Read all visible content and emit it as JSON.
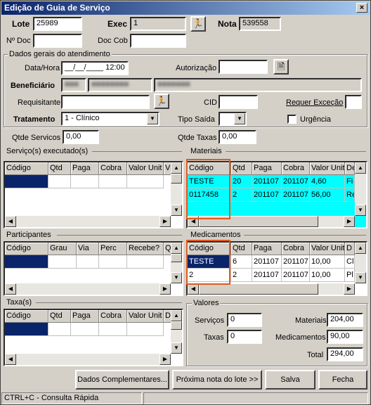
{
  "window": {
    "title": "Edição de Guia de Serviço",
    "close": "×"
  },
  "header": {
    "lote_label": "Lote",
    "lote": "25989",
    "exec_label": "Exec",
    "exec": "1",
    "nota_label": "Nota",
    "nota": "539558",
    "ndoc_label": "Nº Doc",
    "ndoc": "",
    "doccob_label": "Doc Cob",
    "doccob": ""
  },
  "dados": {
    "group_title": "Dados gerais do atendimento",
    "datahora_label": "Data/Hora",
    "datahora": "__/__/____ 12:00",
    "autorizacao_label": "Autorização",
    "autorizacao": "",
    "beneficiario_label": "Beneficiário",
    "requisitante_label": "Requisitante",
    "requisitante": "",
    "cid_label": "CID",
    "cid": "",
    "requer_label": "Requer Exceção",
    "requer": "",
    "tratamento_label": "Tratamento",
    "tratamento": "1 - Clínico",
    "tiposaida_label": "Tipo Saída",
    "tiposaida": "",
    "urgencia_label": "Urgência"
  },
  "qtde": {
    "servicos_label": "Qtde Servicos",
    "servicos": "0,00",
    "taxas_label": "Qtde Taxas",
    "taxas": "0,00"
  },
  "servicos": {
    "title": "Serviço(s) executado(s)",
    "columns": [
      "Código",
      "Qtd",
      "Paga",
      "Cobra",
      "Valor Unit",
      "Vi"
    ]
  },
  "materiais": {
    "title": "Materiais",
    "columns": [
      "Código",
      "Qtd",
      "Paga",
      "Cobra",
      "Valor Unit",
      "De"
    ],
    "rows": [
      [
        "TESTE",
        "20",
        "201107",
        "201107",
        "4,60",
        "Fi"
      ],
      [
        "0117458",
        "2",
        "201107",
        "201107",
        "56,00",
        "Re"
      ]
    ]
  },
  "participantes": {
    "title": "Participantes",
    "columns": [
      "Código",
      "Grau",
      "Via",
      "Perc",
      "Recebe?",
      "Q"
    ]
  },
  "medicamentos": {
    "title": "Medicamentos",
    "columns": [
      "Código",
      "Qtd",
      "Paga",
      "Cobra",
      "Valor Unit",
      "D"
    ],
    "rows": [
      [
        "TESTE",
        "6",
        "201107",
        "201107",
        "10,00",
        "Cl"
      ],
      [
        "2",
        "2",
        "201107",
        "201107",
        "10,00",
        "Pl"
      ]
    ]
  },
  "taxas": {
    "title": "Taxa(s)",
    "columns": [
      "Código",
      "Qtd",
      "Paga",
      "Cobra",
      "Valor Unit",
      "D"
    ]
  },
  "valores": {
    "title": "Valores",
    "servicos_label": "Serviços",
    "servicos": "0",
    "taxas_label": "Taxas",
    "taxas": "0",
    "materiais_label": "Materiais",
    "materiais": "204,00",
    "medicamentos_label": "Medicamentos",
    "medicamentos": "90,00",
    "total_label": "Total",
    "total": "294,00"
  },
  "buttons": {
    "dados_complementares": "Dados Complementares...",
    "proxima_nota": "Próxima nota do lote >>",
    "salva": "Salva",
    "fecha": "Fecha"
  },
  "status": {
    "hint": "CTRL+C - Consulta Rápida"
  }
}
